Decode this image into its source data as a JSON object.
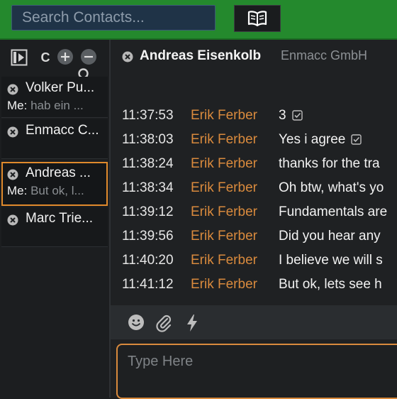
{
  "topbar": {
    "search_placeholder": "Search Contacts..."
  },
  "sidebar": {
    "tools": {
      "letter": "C"
    },
    "contacts": [
      {
        "name": "Volker Pu...",
        "me_label": "Me:",
        "preview": "hab ein ..."
      },
      {
        "name": "Enmacc C...",
        "me_label": "",
        "preview": ""
      },
      {
        "name": "Andreas ...",
        "me_label": "Me:",
        "preview": "But ok, l..."
      },
      {
        "name": "Marc Trie...",
        "me_label": "",
        "preview": ""
      }
    ]
  },
  "chat": {
    "contact_name": "Andreas Eisenkolb",
    "company": "Enmacc GmbH",
    "messages": [
      {
        "time": "11:37:53",
        "sender": "Erik Ferber",
        "text": "3",
        "tick": true
      },
      {
        "time": "11:38:03",
        "sender": "Erik Ferber",
        "text": "Yes i agree",
        "tick": true
      },
      {
        "time": "11:38:24",
        "sender": "Erik Ferber",
        "text": "thanks for the tra",
        "tick": false
      },
      {
        "time": "11:38:34",
        "sender": "Erik Ferber",
        "text": "Oh btw, what's yo",
        "tick": false
      },
      {
        "time": "11:39:12",
        "sender": "Erik Ferber",
        "text": "Fundamentals are",
        "tick": false
      },
      {
        "time": "11:39:56",
        "sender": "Erik Ferber",
        "text": "Did you hear any",
        "tick": false
      },
      {
        "time": "11:40:20",
        "sender": "Erik Ferber",
        "text": "I believe we will s",
        "tick": false
      },
      {
        "time": "11:41:12",
        "sender": "Erik Ferber",
        "text": "But ok, lets see h",
        "tick": false
      }
    ],
    "input_placeholder": "Type Here"
  },
  "icons": {
    "book": "book-icon",
    "panel": "panel-toggle-icon",
    "add": "plus-icon",
    "remove": "minus-icon",
    "search": "search-icon",
    "close": "close-icon",
    "tick": "check-icon",
    "emoji": "smiley-icon",
    "attach": "paperclip-icon",
    "quick": "lightning-icon"
  },
  "colors": {
    "topbar": "#24892d",
    "accent": "#d98a3d",
    "search_bg": "#1f3347"
  }
}
